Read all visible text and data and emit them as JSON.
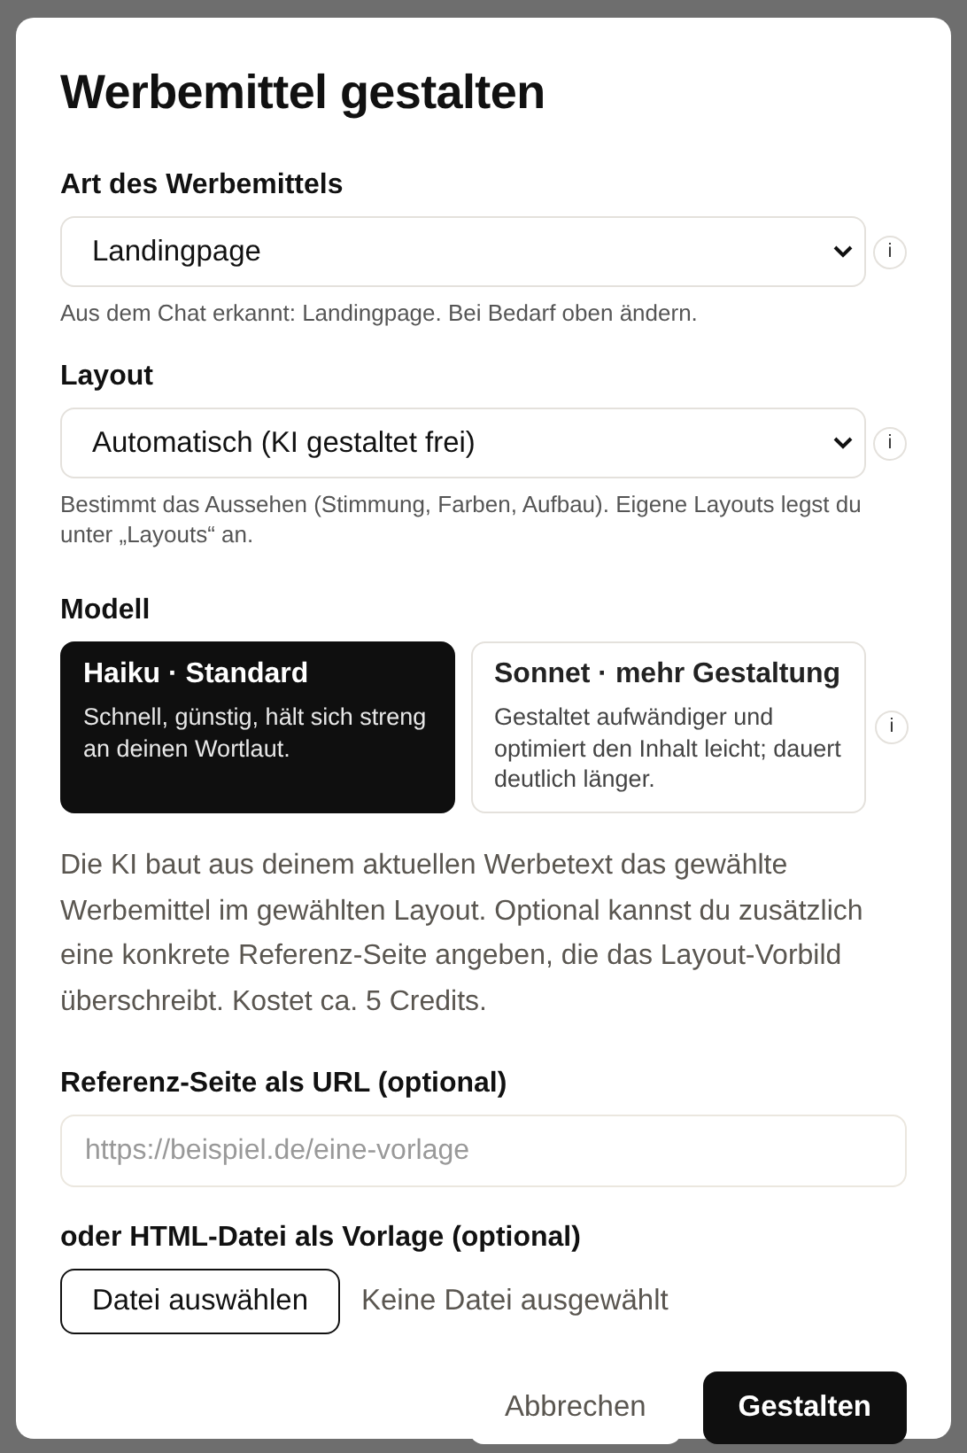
{
  "dialog": {
    "title": "Werbemittel gestalten",
    "fields": [
      {
        "kind": "select",
        "label": "Art des Werbemittels",
        "value": "Landingpage",
        "info": "i",
        "hint": "Aus dem Chat erkannt: Landingpage. Bei Bedarf oben ändern."
      },
      {
        "kind": "select",
        "label": "Layout",
        "value": "Automatisch (KI gestaltet frei)",
        "info": "i",
        "hint": "Bestimmt das Aussehen (Stimmung, Farben, Aufbau). Eigene Layouts legst du unter „Layouts“ an."
      }
    ],
    "model": {
      "label": "Modell",
      "info": "i",
      "options": [
        {
          "title": "Haiku · Standard",
          "description": "Schnell, günstig, hält sich streng an deinen Wortlaut.",
          "selected": true
        },
        {
          "title": "Sonnet · mehr Gestaltung",
          "description": "Gestaltet aufwändiger und optimiert den Inhalt leicht; dauert deutlich länger.",
          "selected": false
        }
      ]
    },
    "description": "Die KI baut aus deinem aktuellen Werbetext das gewählte Werbemittel im gewählten Layout. Optional kannst du zusätzlich eine konkrete Referenz-Seite angeben, die das Layout-Vorbild überschreibt. Kostet ca. 5 Credits.",
    "reference_url": {
      "label": "Referenz-Seite als URL (optional)",
      "placeholder": "https://beispiel.de/eine-vorlage"
    },
    "html_file": {
      "label": "oder HTML-Datei als Vorlage (optional)",
      "button": "Datei auswählen",
      "status": "Keine Datei ausgewählt"
    },
    "buttons": [
      {
        "kind": "secondary",
        "label": "Abbrechen"
      },
      {
        "kind": "primary",
        "label": "Gestalten"
      }
    ]
  }
}
